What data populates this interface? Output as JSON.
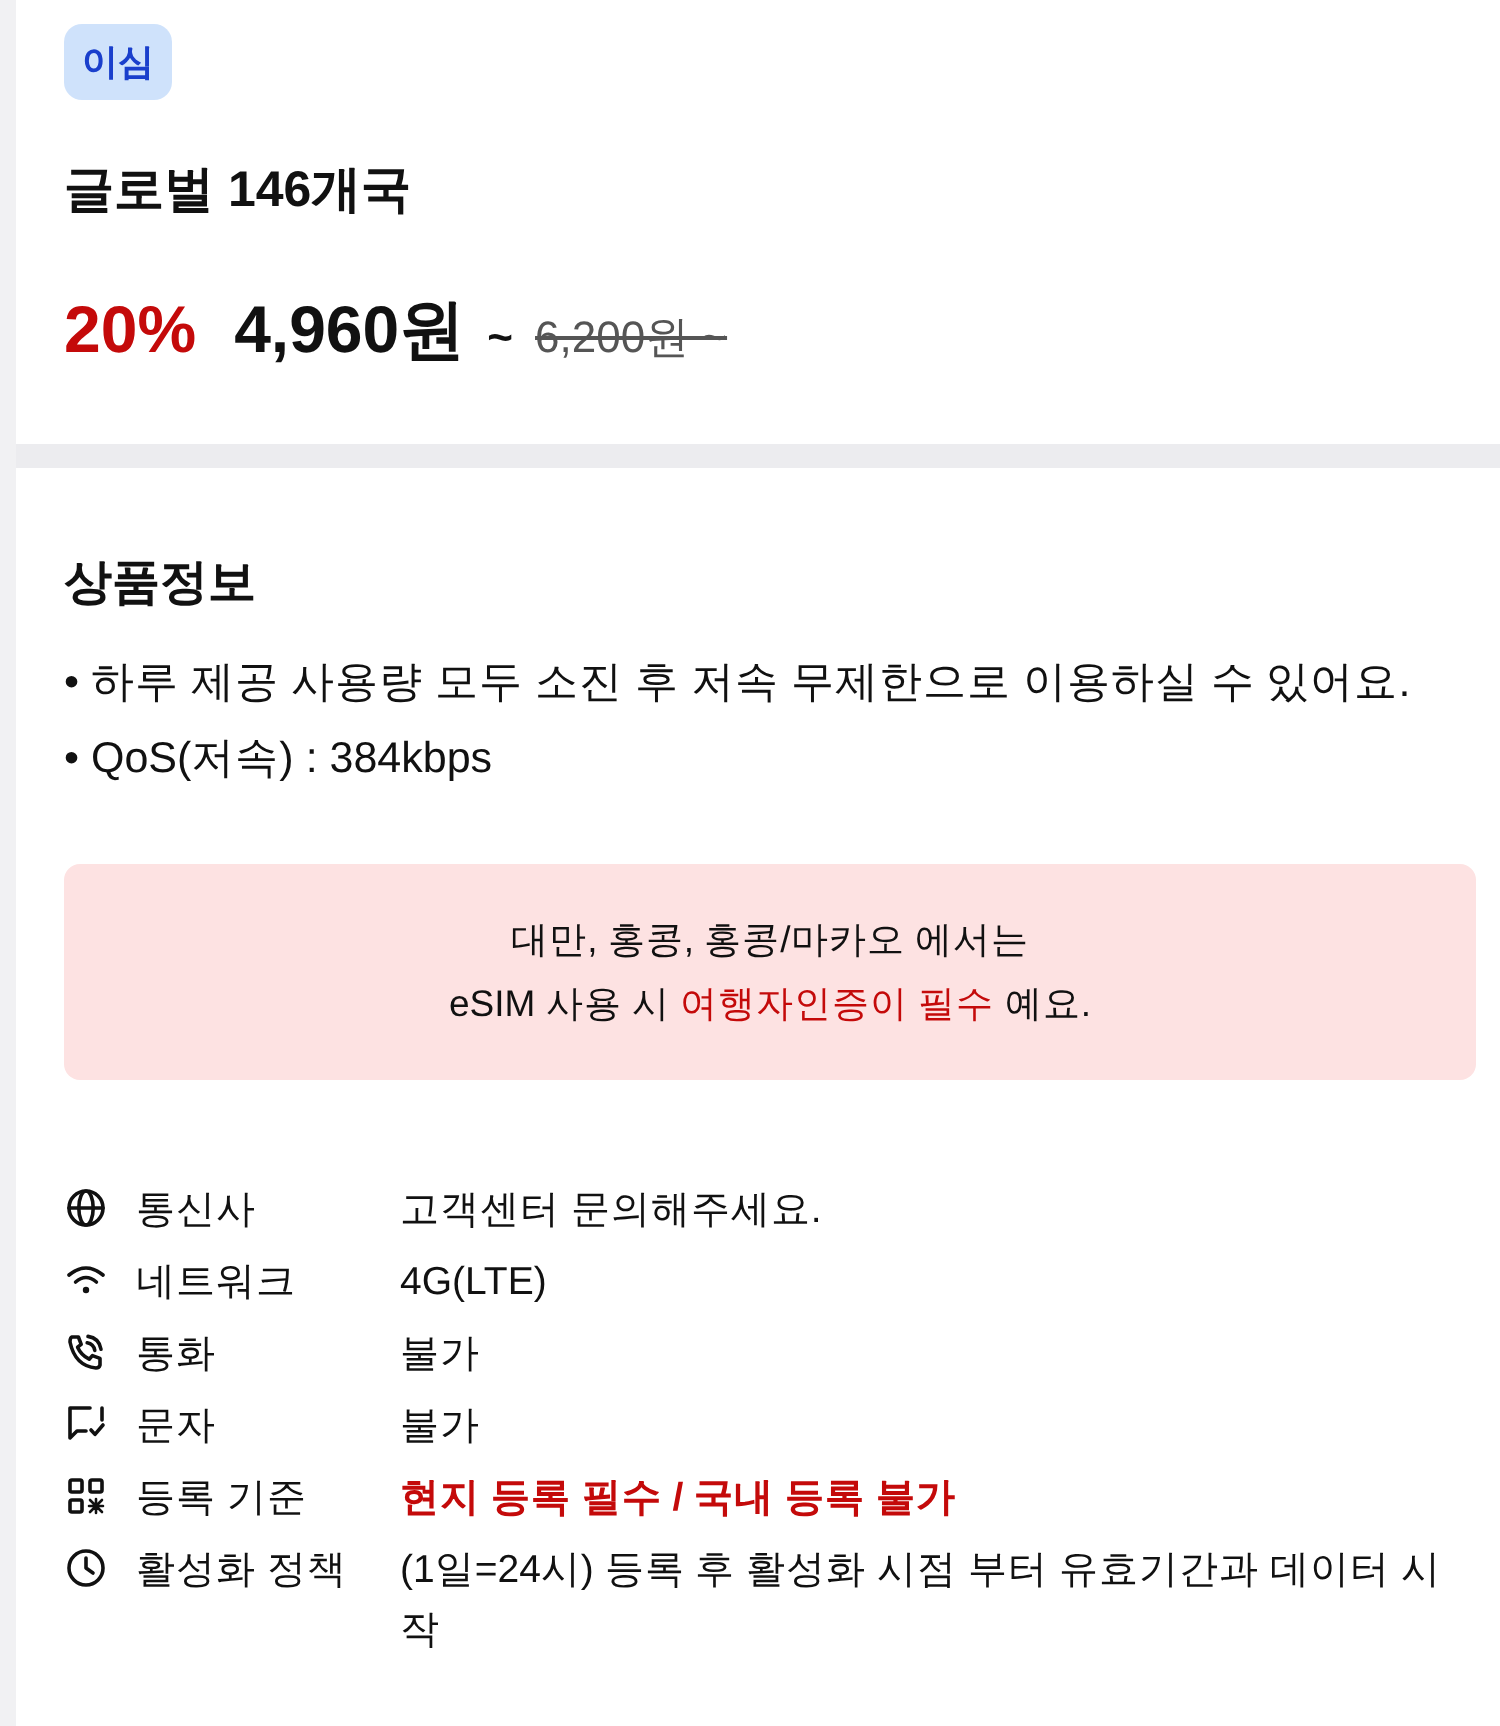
{
  "badge": {
    "label": "이심"
  },
  "product": {
    "title": "글로벌 146개국",
    "discount": "20%",
    "price": "4,960원",
    "price_suffix": "~",
    "original_price": "6,200원 ~"
  },
  "info": {
    "heading": "상품정보",
    "bullets": [
      "• 하루 제공 사용량 모두 소진 후 저속 무제한으로 이용하실 수 있어요.",
      "• QoS(저속) : 384kbps"
    ]
  },
  "notice": {
    "lines": [
      {
        "segments": [
          {
            "text": "대만, 홍콩, 홍콩/마카오 에서는",
            "highlight": false
          }
        ]
      },
      {
        "segments": [
          {
            "text": "eSIM 사용 시 ",
            "highlight": false
          },
          {
            "text": "여행자인증이 필수",
            "highlight": true
          },
          {
            "text": " 예요.",
            "highlight": false
          }
        ]
      }
    ]
  },
  "details": [
    {
      "kind": "carrier",
      "label": "통신사",
      "value": "고객센터 문의해주세요.",
      "highlight": false
    },
    {
      "kind": "network",
      "label": "네트워크",
      "value": "4G(LTE)",
      "highlight": false
    },
    {
      "kind": "call",
      "label": "통화",
      "value": "불가",
      "highlight": false
    },
    {
      "kind": "sms",
      "label": "문자",
      "value": "불가",
      "highlight": false
    },
    {
      "kind": "registration",
      "label": "등록 기준",
      "value": "현지 등록 필수 / 국내 등록 불가",
      "highlight": true
    },
    {
      "kind": "activation",
      "label": "활성화 정책",
      "value": "(1일=24시) 등록 후 활성화 시점 부터 유효기간과 데이터 시작",
      "highlight": false
    }
  ]
}
